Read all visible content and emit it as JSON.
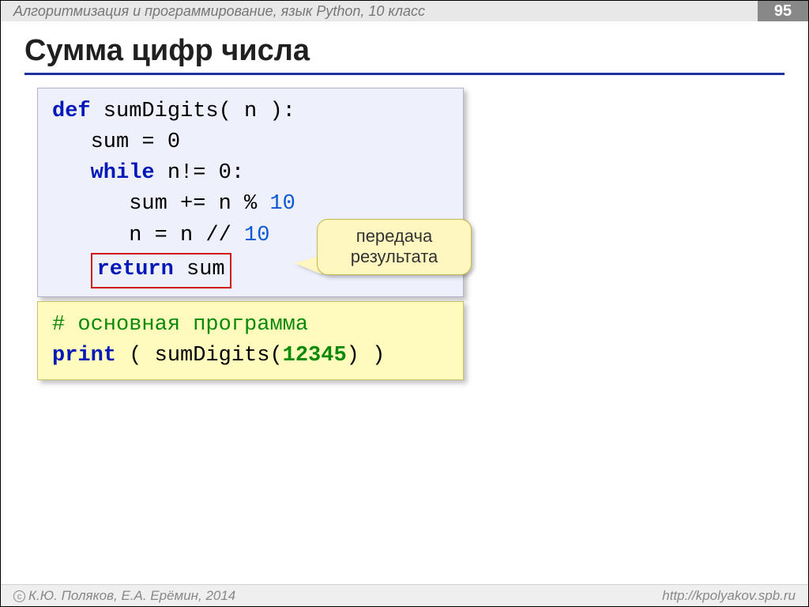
{
  "header": {
    "course": "Алгоритмизация и программирование, язык Python, 10 класс",
    "page": "95"
  },
  "title": "Сумма цифр числа",
  "code1": {
    "l1_def": "def",
    "l1_rest": " sumDigits( n ):",
    "l2": "sum = 0",
    "l3_while": "while",
    "l3_rest": " n!= 0:",
    "l4_a": "sum += n % ",
    "l4_num": "10",
    "l5_a": "n = n // ",
    "l5_num": "10",
    "l6_return": "return",
    "l6_rest": " sum"
  },
  "callout": {
    "line1": "передача",
    "line2": "результата"
  },
  "code2": {
    "comment": "# основная программа",
    "print": "print",
    "open": " ( sumDigits(",
    "arg": "12345",
    "close": ") )"
  },
  "footer": {
    "authors": "К.Ю. Поляков, Е.А. Ерёмин, 2014",
    "url": "http://kpolyakov.spb.ru"
  }
}
